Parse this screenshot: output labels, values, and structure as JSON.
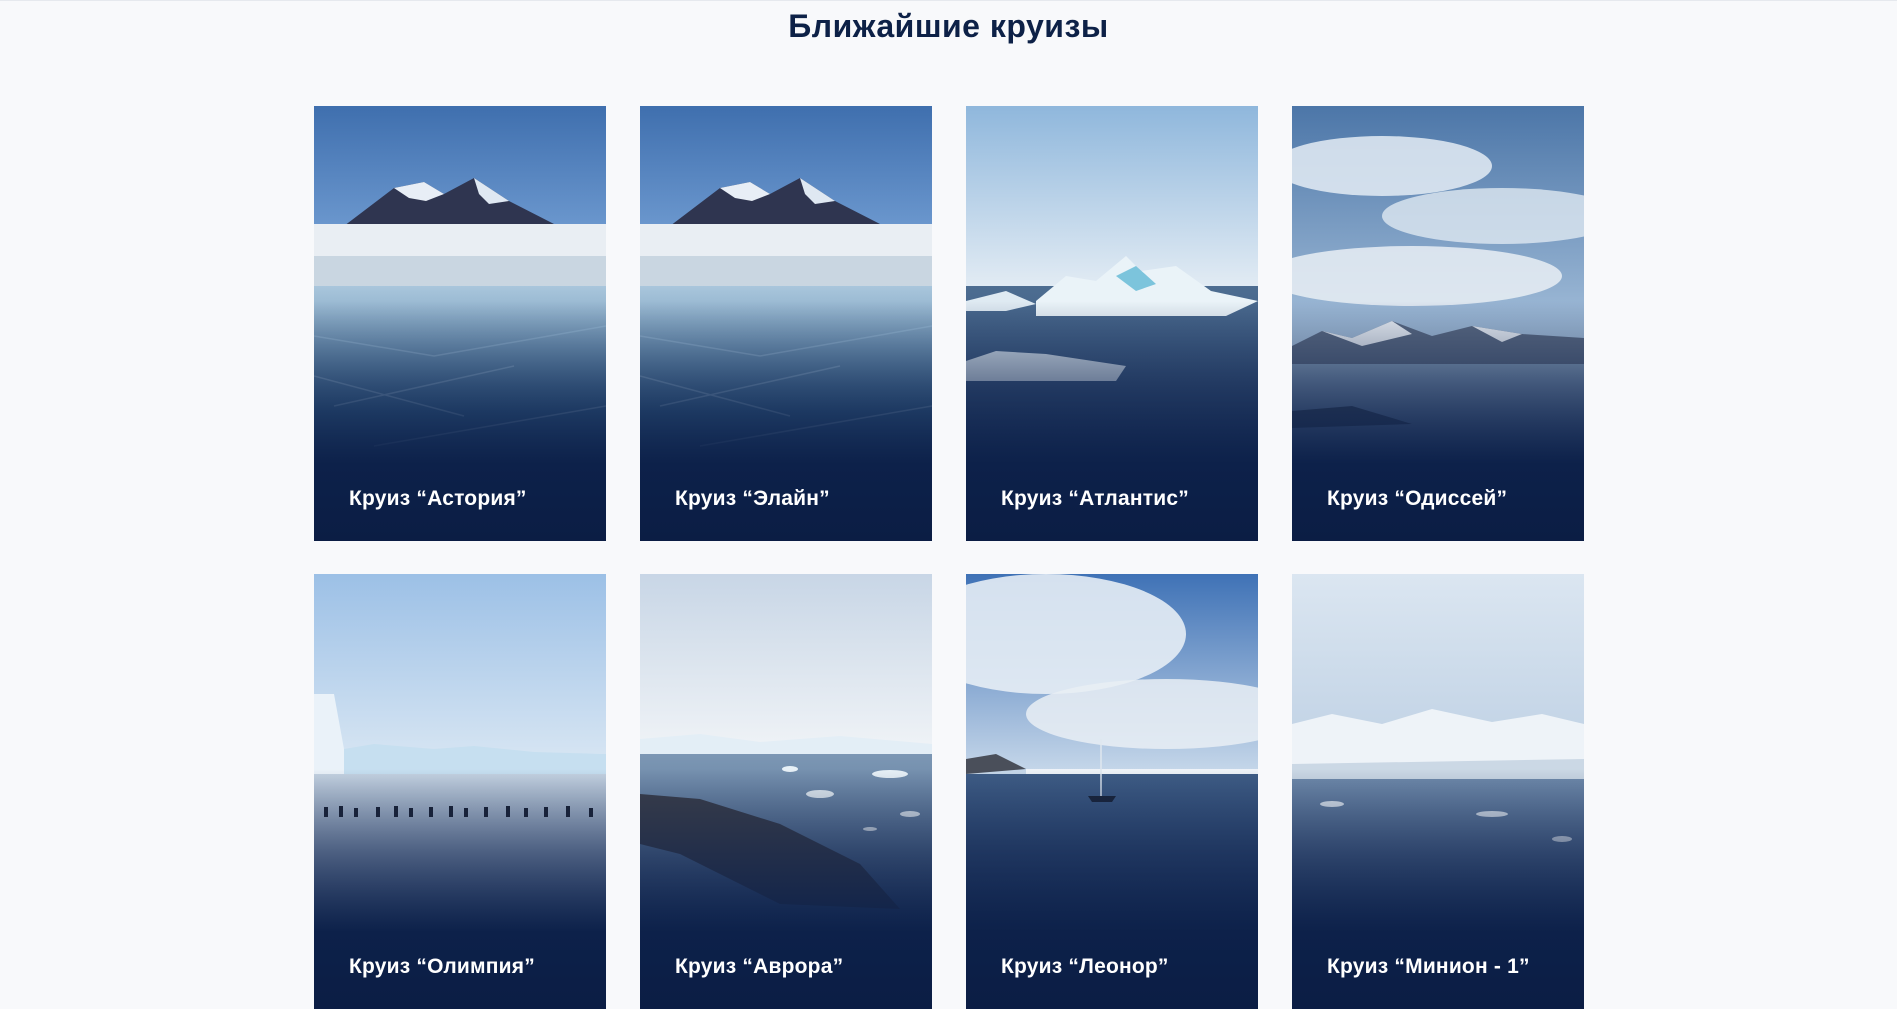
{
  "section": {
    "title": "Ближайшие круизы"
  },
  "colors": {
    "background": "#f8f9fb",
    "title": "#0d2147",
    "card_overlay": "#0d214a",
    "label": "#ffffff"
  },
  "cruises": [
    {
      "name": "Круиз “Астория”",
      "scene": "glacier-ice"
    },
    {
      "name": "Круиз “Элайн”",
      "scene": "glacier-ice"
    },
    {
      "name": "Круиз “Атлантис”",
      "scene": "icebergs-sea"
    },
    {
      "name": "Круиз “Одиссей”",
      "scene": "cloudy-mountains"
    },
    {
      "name": "Круиз “Олимпия”",
      "scene": "penguins-ice-shelf"
    },
    {
      "name": "Круиз “Аврора”",
      "scene": "bay-ice-floes"
    },
    {
      "name": "Круиз “Леонор”",
      "scene": "sailboat-bay"
    },
    {
      "name": "Круиз “Минион - 1”",
      "scene": "snowy-coast"
    }
  ]
}
